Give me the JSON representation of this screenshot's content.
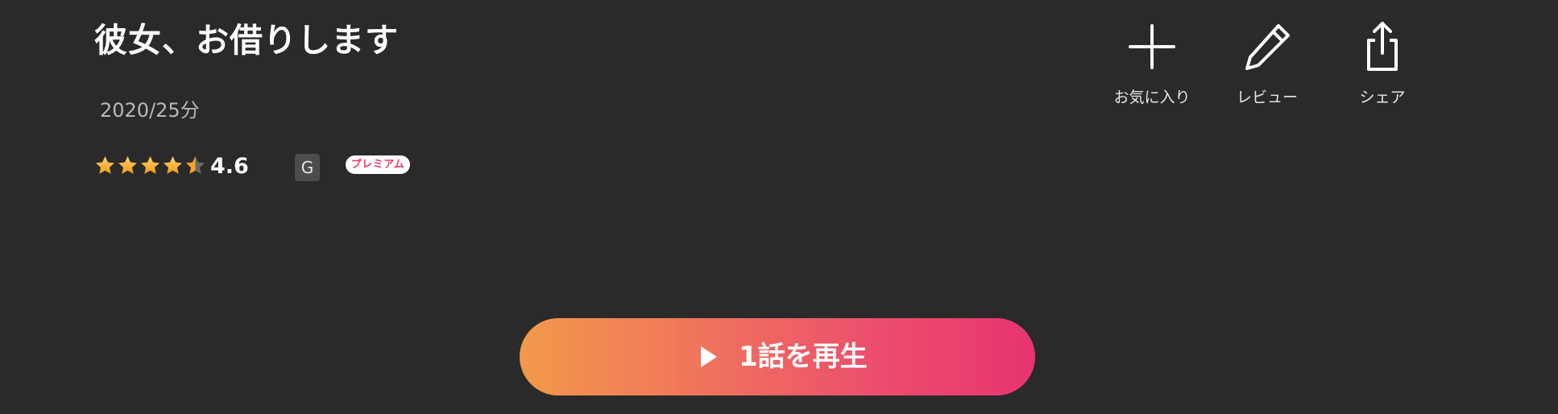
{
  "title": "彼女、お借りします",
  "meta": "2020/25分",
  "rating": {
    "value": "4.6",
    "stars_filled": 4.5,
    "stars_total": 5
  },
  "age_rating": "G",
  "premium_label": "プレミアム",
  "actions": {
    "favorite": {
      "label": "お気に入り",
      "icon": "plus-icon"
    },
    "review": {
      "label": "レビュー",
      "icon": "pencil-icon"
    },
    "share": {
      "label": "シェア",
      "icon": "share-icon"
    }
  },
  "play_button": {
    "label": "1話を再生",
    "icon": "play-icon"
  },
  "colors": {
    "background": "#2a2a2a",
    "star_gold": "#f5a623",
    "premium_pink": "#e8396b",
    "gradient_start": "#f2994a",
    "gradient_end": "#e8346f"
  }
}
